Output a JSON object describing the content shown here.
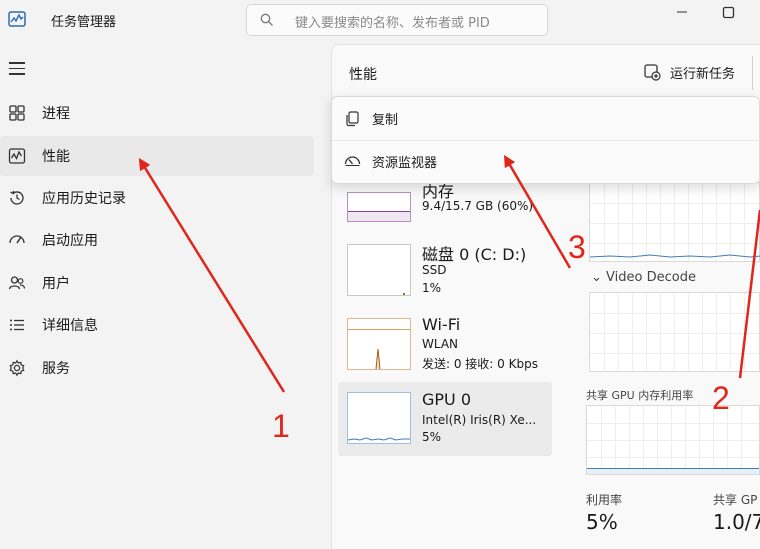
{
  "titlebar": {
    "app_title": "任务管理器",
    "search_placeholder": "键入要搜索的名称、发布者或 PID",
    "window_controls": [
      "minimize-icon",
      "maximize-icon"
    ]
  },
  "sidebar": {
    "items": [
      {
        "label": "进程",
        "icon": "processes-icon"
      },
      {
        "label": "性能",
        "icon": "performance-icon",
        "active": true
      },
      {
        "label": "应用历史记录",
        "icon": "app-history-icon"
      },
      {
        "label": "启动应用",
        "icon": "startup-apps-icon"
      },
      {
        "label": "用户",
        "icon": "users-icon"
      },
      {
        "label": "详细信息",
        "icon": "details-icon"
      },
      {
        "label": "服务",
        "icon": "services-icon"
      }
    ]
  },
  "header": {
    "title": "性能",
    "run_new_task": "运行新任务"
  },
  "context_menu": {
    "items": [
      {
        "label": "复制",
        "icon": "copy-icon"
      },
      {
        "label": "资源监视器",
        "icon": "resource-monitor-icon"
      }
    ]
  },
  "devices": [
    {
      "name": "内存",
      "sub1": "9.4/15.7 GB (60%)",
      "sub2": ""
    },
    {
      "name": "磁盘 0 (C: D:)",
      "sub1": "SSD",
      "sub2": "1%"
    },
    {
      "name": "Wi-Fi",
      "sub1": "WLAN",
      "sub2": "发送: 0 接收: 0 Kbps"
    },
    {
      "name": "GPU 0",
      "sub1": "Intel(R) Iris(R) Xe...",
      "sub2": "5%"
    }
  ],
  "gpu_panel": {
    "video_decode_label": "Video Decode",
    "shared_memory_label": "共享 GPU 内存利用率",
    "utilization_label": "利用率",
    "utilization_value": "5%",
    "shared_label": "共享 GP",
    "shared_value": "1.0/7"
  },
  "annotations": [
    "1",
    "2",
    "3"
  ],
  "colors": {
    "memory": "#8e3a9b",
    "disk": "#4e9a06",
    "wifi": "#b0580e",
    "gpu": "#3b7dbf",
    "arrow": "#e0261b"
  }
}
